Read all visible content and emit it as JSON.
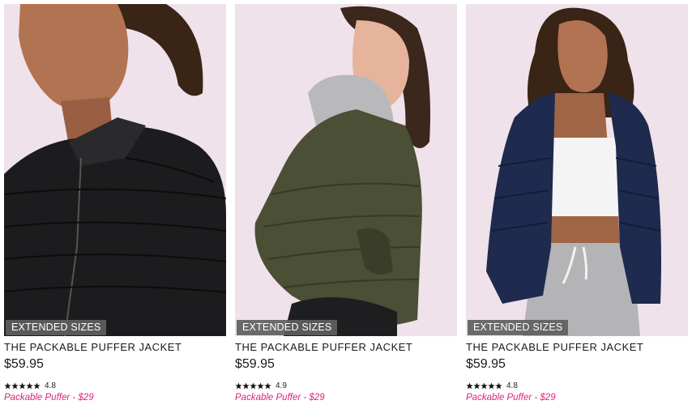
{
  "products": [
    {
      "badge": "EXTENDED SIZES",
      "name": "THE PACKABLE PUFFER JACKET",
      "price": "$59.95",
      "rating_value": "4.8",
      "stars": 5,
      "promo": "Packable Puffer - $29",
      "jacket_color": "#1c1c1e"
    },
    {
      "badge": "EXTENDED SIZES",
      "name": "THE PACKABLE PUFFER JACKET",
      "price": "$59.95",
      "rating_value": "4.9",
      "stars": 5,
      "promo": "Packable Puffer - $29",
      "jacket_color": "#4a4f35"
    },
    {
      "badge": "EXTENDED SIZES",
      "name": "THE PACKABLE PUFFER JACKET",
      "price": "$59.95",
      "rating_value": "4.8",
      "stars": 5,
      "promo": "Packable Puffer - $29",
      "jacket_color": "#1e2a4e"
    }
  ],
  "colors": {
    "photo_background": "#efe2ea",
    "promo_text": "#e0207a",
    "badge_background": "#5f5f5f"
  }
}
